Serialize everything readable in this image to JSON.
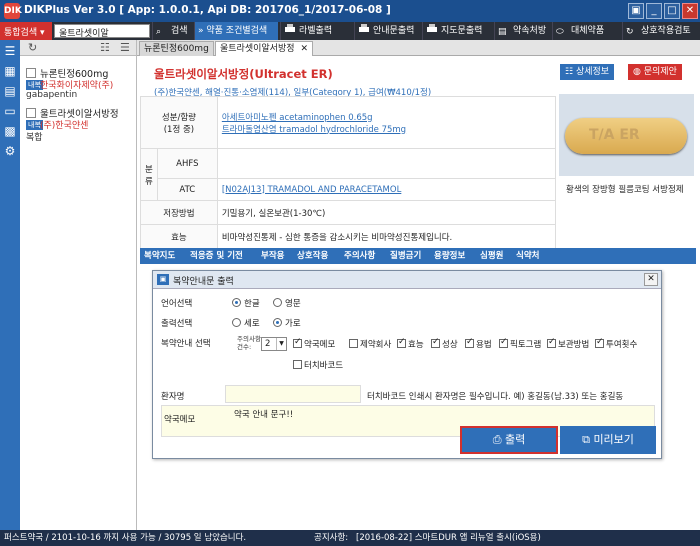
{
  "window": {
    "title": "DIKPlus Ver 3.0 [ App: 1.0.0.1, Api DB: 201706_1/2017-06-08 ]",
    "app_icon": "DIK",
    "controls": [
      "▣",
      "_",
      "□",
      "✕"
    ]
  },
  "toolbar": {
    "combo_label": "통합검색",
    "search_value": "울트라셋이알",
    "search_button": "검색",
    "condition_button": "약품 조건별검색",
    "buttons": [
      "라벨출력",
      "안내문출력",
      "지도문출력",
      "약속처방",
      "대체약품",
      "상호작용검토"
    ]
  },
  "left_panel": {
    "head_icons": [
      "refresh-icon",
      "list-icon",
      "sort-icon"
    ],
    "items": [
      {
        "name": "뉴론틴정600mg",
        "badge": "내복",
        "maker": "한국화이자제약(주)",
        "sub": "gabapentin"
      },
      {
        "name": "울트라셋이알서방정",
        "badge": "내복",
        "maker": "(주)한국얀센",
        "sub": "복합"
      }
    ]
  },
  "tabs": [
    {
      "label": "뉴론틴정600mg"
    },
    {
      "label": "울트라셋이알서방정",
      "close": "✕"
    }
  ],
  "drug": {
    "title": "울트라셋이알서방정(Ultracet ER)",
    "subtitle": "(주)한국얀센, 해열·진통·소염제(114), 일부(Category 1), 급여(₩410/1정)",
    "detail_button": "상세정보",
    "inquiry_button": "문의제안",
    "image_label": "T/A ER",
    "ingredient_label": "성분/함량",
    "ingredient_sub": "(1정 중)",
    "ingredients": [
      "아세트아미노펜 acetaminophen 0.65g",
      "트라마돌염산염 tramadol hydrochloride 75mg"
    ],
    "class_label": "분류",
    "ahfs_label": "AHFS",
    "atc_label": "ATC",
    "atc_value": "[N02AJ13] TRAMADOL AND PARACETAMOL",
    "storage_label": "저장방법",
    "storage_value": "기밀용기, 실온보관(1-30℃)",
    "effect_label": "효능",
    "effect_value": "비마약성진통제 - 심한 통증을 감소시키는 비마약성진통제입니다.",
    "description": "황색의 장방형 필름코팅 서방정제"
  },
  "categories": [
    "복약지도",
    "적응증 및 기전",
    "부작용",
    "상호작용",
    "주의사항",
    "질병금기",
    "용량정보",
    "심평원",
    "식약처"
  ],
  "dialog": {
    "title": "복약안내문 출력",
    "language_label": "언어선택",
    "language_options": [
      "한글",
      "영문"
    ],
    "language_selected": 0,
    "orientation_label": "출력선택",
    "orientation_options": [
      "세로",
      "가로"
    ],
    "orientation_selected": 1,
    "guide_label": "복약안내 선택",
    "caution_count_label": "주의사항 건수:",
    "caution_count_value": "2",
    "checks_row1": [
      "약국메모",
      "제약회사",
      "효능",
      "성상",
      "용법",
      "픽토그램",
      "보관방법",
      "투여횟수"
    ],
    "checks_row1_state": [
      true,
      false,
      true,
      true,
      true,
      true,
      true,
      true
    ],
    "checks_row2": [
      "터치바코드"
    ],
    "checks_row2_state": [
      false
    ],
    "patient_label": "환자명",
    "patient_value": "",
    "patient_hint": "터치바코드 인쇄시 환자명은 필수입니다. 예) 홍길동(남.33) 또는 홍길동",
    "memo_label": "약국메모",
    "memo_value": "약국 안내 문구!!",
    "print_button": "출력",
    "preview_button": "미리보기",
    "close": "✕"
  },
  "status": {
    "left": "퍼스트약국 / 2101-10-16 까지 사용 가능 / 30795 일 남았습니다.",
    "notice_label": "공지사항:",
    "notice_value": "[2016-08-22] 스마트DUR 앱 리뉴얼 출시(iOS용)"
  },
  "colors": {
    "accent": "#2f6fb8",
    "brand_red": "#d2312e",
    "title_bar": "#1b4f8f"
  }
}
